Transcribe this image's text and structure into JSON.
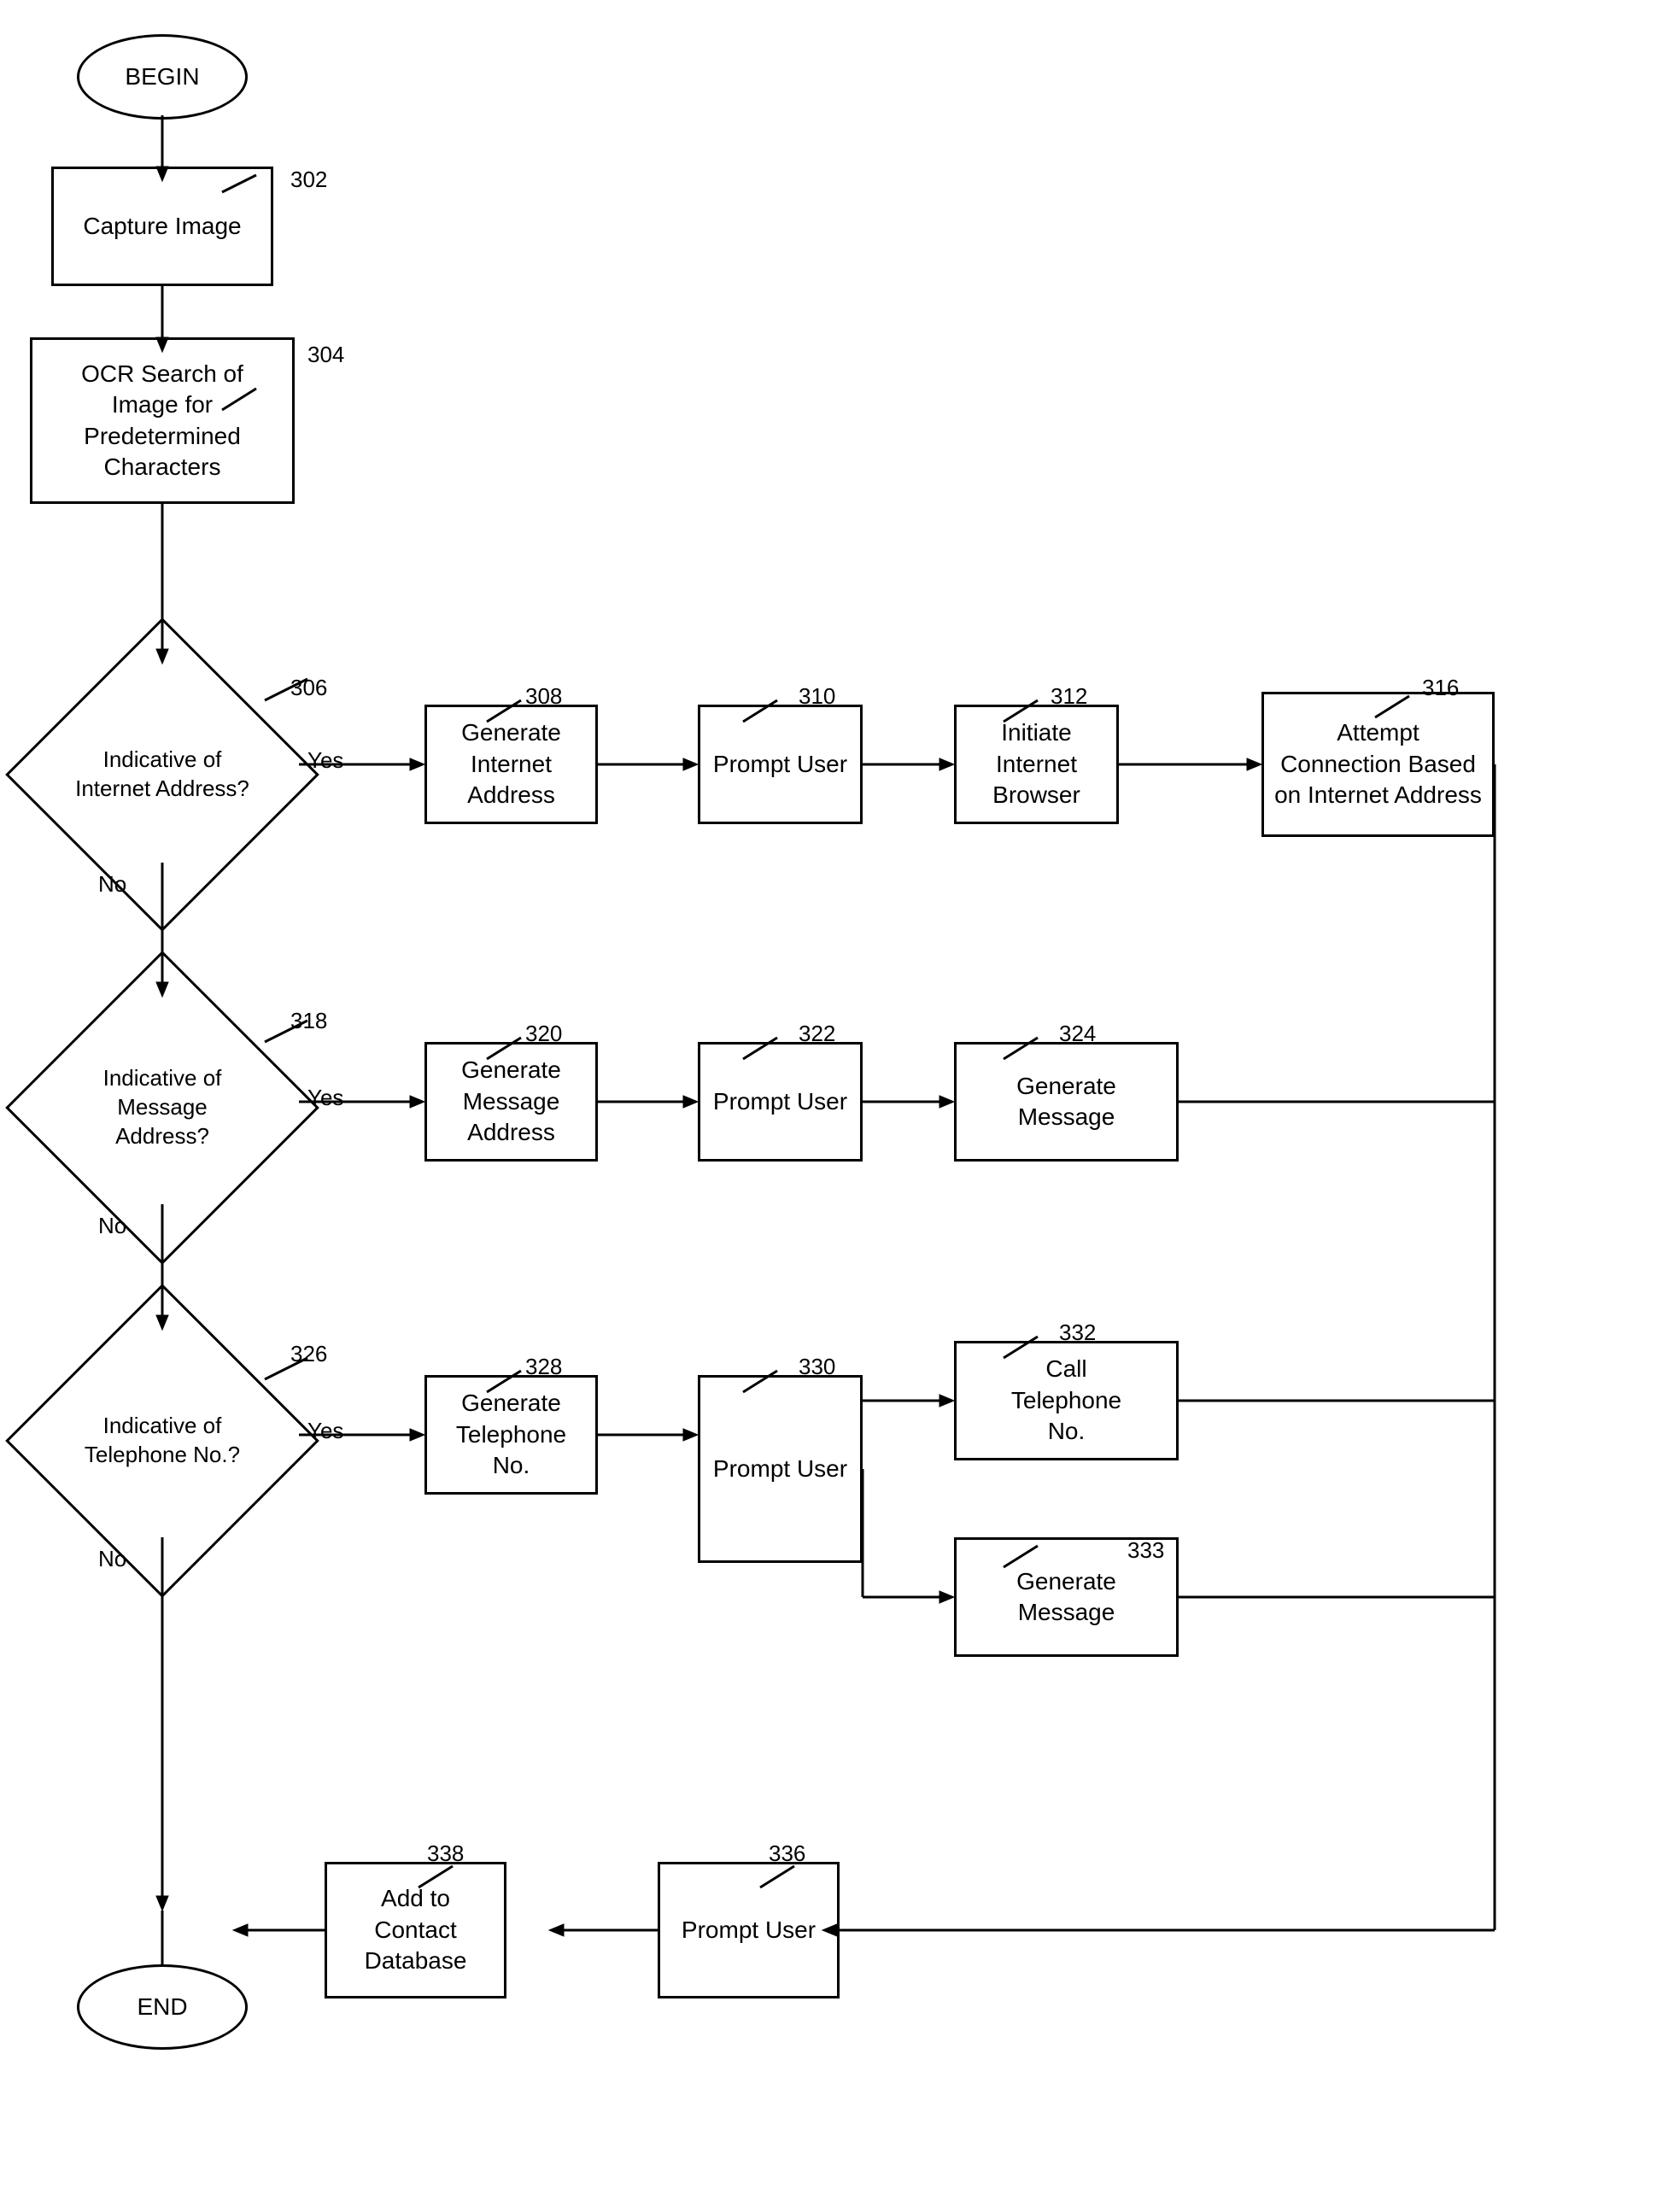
{
  "nodes": {
    "begin": {
      "label": "BEGIN"
    },
    "capture_image": {
      "label": "Capture Image"
    },
    "ocr_search": {
      "label": "OCR Search of\nImage for\nPredetermined\nCharacters"
    },
    "indicative_internet": {
      "label": "Indicative of\nInternet Address?"
    },
    "generate_internet": {
      "label": "Generate\nInternet\nAddress"
    },
    "prompt_user_310": {
      "label": "Prompt User"
    },
    "initiate_browser": {
      "label": "Initiate\nInternet\nBrowser"
    },
    "attempt_connection": {
      "label": "Attempt\nConnection Based\non Internet Address"
    },
    "indicative_message": {
      "label": "Indicative of\nMessage\nAddress?"
    },
    "generate_message_addr": {
      "label": "Generate\nMessage\nAddress"
    },
    "prompt_user_322": {
      "label": "Prompt User"
    },
    "generate_message_324": {
      "label": "Generate\nMessage"
    },
    "indicative_telephone": {
      "label": "Indicative of\nTelephone No.?"
    },
    "generate_telephone": {
      "label": "Generate\nTelephone\nNo."
    },
    "prompt_user_330": {
      "label": "Prompt User"
    },
    "call_telephone": {
      "label": "Call\nTelephone\nNo."
    },
    "generate_message_333": {
      "label": "Generate\nMessage"
    },
    "prompt_user_336": {
      "label": "Prompt User"
    },
    "add_contact": {
      "label": "Add to\nContact\nDatabase"
    },
    "end": {
      "label": "END"
    }
  },
  "labels": {
    "n302": "302",
    "n304": "304",
    "n306": "306",
    "n308": "308",
    "n310": "310",
    "n312": "312",
    "n316": "316",
    "n318": "318",
    "n320": "320",
    "n322": "322",
    "n324": "324",
    "n326": "326",
    "n328": "328",
    "n330": "330",
    "n332": "332",
    "n333": "333",
    "n336": "336",
    "n338": "338",
    "yes": "Yes",
    "no": "No"
  }
}
